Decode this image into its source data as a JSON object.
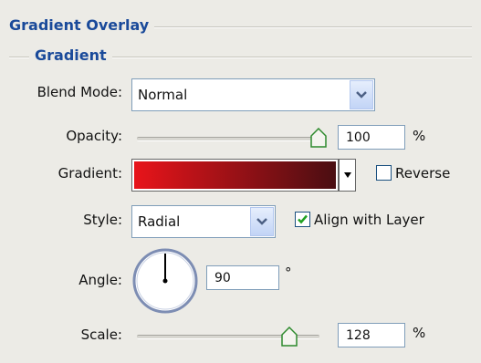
{
  "panel": {
    "title": "Gradient Overlay",
    "section": "Gradient"
  },
  "blend_mode": {
    "label": "Blend Mode:",
    "value": "Normal"
  },
  "opacity": {
    "label": "Opacity:",
    "value": "100",
    "unit": "%",
    "slider_fraction": 1.0
  },
  "gradient": {
    "label": "Gradient:",
    "colors": [
      "#e8141a",
      "#4a0e12"
    ],
    "reverse_label": "Reverse",
    "reverse_checked": false
  },
  "style": {
    "label": "Style:",
    "value": "Radial",
    "align_label": "Align with Layer",
    "align_checked": true
  },
  "angle": {
    "label": "Angle:",
    "value": "90",
    "unit": "°"
  },
  "scale": {
    "label": "Scale:",
    "value": "128",
    "unit": "%",
    "slider_fraction": 0.85
  },
  "colors": {
    "title_blue": "#1a4a9a",
    "check_green": "#21a121",
    "dropdown_arrow": "#4d6185"
  }
}
